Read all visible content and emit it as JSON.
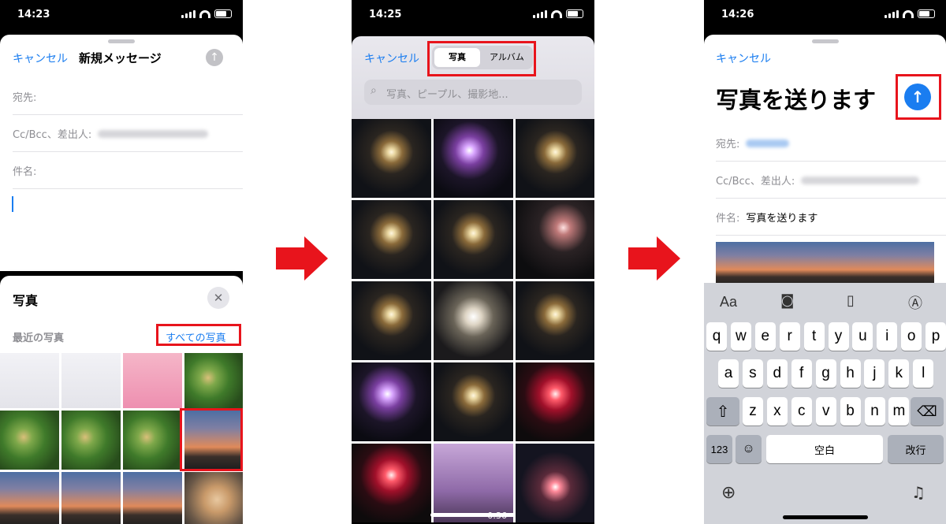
{
  "colors": {
    "accent": "#1a7df0",
    "highlight": "#e8141c"
  },
  "screen1": {
    "time": "14:23",
    "cancel": "キャンセル",
    "title": "新規メッセージ",
    "to_label": "宛先:",
    "cc_label": "Cc/Bcc、差出人:",
    "subject_label": "件名:",
    "panel_title": "写真",
    "recent": "最近の写真",
    "all_photos": "すべての写真"
  },
  "screen2": {
    "time": "14:25",
    "cancel": "キャンセル",
    "seg_photos": "写真",
    "seg_albums": "アルバム",
    "search_placeholder": "写真、ピープル、撮影地...",
    "video_duration": "0:36"
  },
  "screen3": {
    "time": "14:26",
    "cancel": "キャンセル",
    "title": "写真を送ります",
    "to_label": "宛先:",
    "cc_label": "Cc/Bcc、差出人:",
    "subject_label": "件名:",
    "subject_value": "写真を送ります",
    "toolbar": [
      "Aa",
      "camera-icon",
      "document-icon",
      "markup-icon"
    ],
    "rows": [
      [
        "q",
        "w",
        "e",
        "r",
        "t",
        "y",
        "u",
        "i",
        "o",
        "p"
      ],
      [
        "a",
        "s",
        "d",
        "f",
        "g",
        "h",
        "j",
        "k",
        "l"
      ],
      [
        "z",
        "x",
        "c",
        "v",
        "b",
        "n",
        "m"
      ]
    ],
    "key_123": "123",
    "key_space": "空白",
    "key_return": "改行"
  }
}
